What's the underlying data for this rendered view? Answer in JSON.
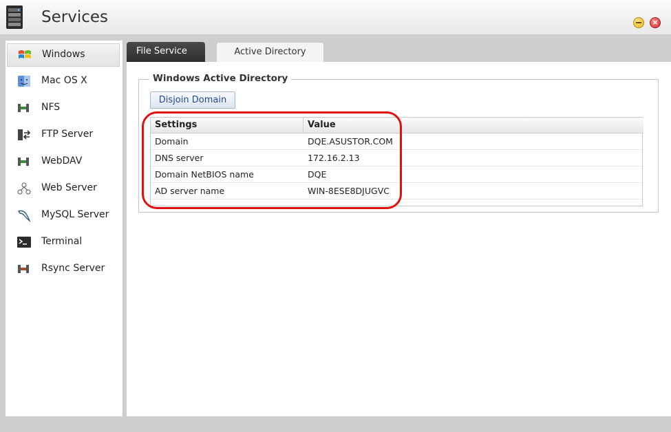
{
  "window": {
    "title": "Services",
    "app_icon": "server-tower-icon",
    "controls": {
      "minimize_icon": "minimize-icon",
      "close_icon": "close-icon",
      "close_glyph": "×"
    }
  },
  "sidebar": {
    "items": [
      {
        "label": "Windows",
        "icon": "windows-logo-icon",
        "active": true
      },
      {
        "label": "Mac OS X",
        "icon": "mac-finder-icon",
        "active": false
      },
      {
        "label": "NFS",
        "icon": "nfs-icon",
        "active": false
      },
      {
        "label": "FTP Server",
        "icon": "ftp-server-icon",
        "active": false
      },
      {
        "label": "WebDAV",
        "icon": "webdav-icon",
        "active": false
      },
      {
        "label": "Web Server",
        "icon": "web-server-icon",
        "active": false
      },
      {
        "label": "MySQL Server",
        "icon": "mysql-dolphin-icon",
        "active": false
      },
      {
        "label": "Terminal",
        "icon": "terminal-icon",
        "active": false
      },
      {
        "label": "Rsync Server",
        "icon": "rsync-icon",
        "active": false
      }
    ]
  },
  "tabs": [
    {
      "label": "File Service",
      "active": false
    },
    {
      "label": "Active Directory",
      "active": true
    }
  ],
  "section": {
    "legend": "Windows Active Directory",
    "disjoin_label": "Disjoin Domain"
  },
  "table": {
    "headers": [
      "Settings",
      "Value"
    ],
    "rows": [
      {
        "setting": "Domain",
        "value": "DQE.ASUSTOR.COM"
      },
      {
        "setting": "DNS server",
        "value": "172.16.2.13"
      },
      {
        "setting": "Domain NetBIOS name",
        "value": "DQE"
      },
      {
        "setting": "AD server name",
        "value": "WIN-8ESE8DJUGVC"
      }
    ]
  },
  "colors": {
    "annotation": "#e01010",
    "active_tab_dark": "#2e2e2e",
    "button_text": "#234a8a"
  }
}
